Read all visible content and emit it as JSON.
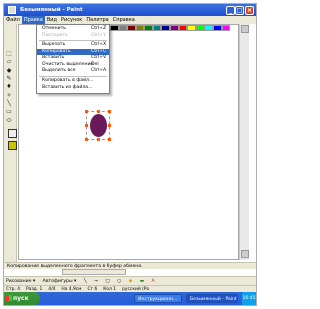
{
  "window": {
    "title": "Безымянный - Paint"
  },
  "menubar": {
    "items": [
      "Файл",
      "Правка",
      "Вид",
      "Рисунок",
      "Палитра",
      "Справка"
    ]
  },
  "edit_menu": {
    "items": [
      {
        "label": "Отменить",
        "shortcut": "Ctrl+Z",
        "state": "normal"
      },
      {
        "label": "Повторить",
        "shortcut": "Ctrl+Y",
        "state": "disabled"
      },
      {
        "label": "Вырезать",
        "shortcut": "Ctrl+X",
        "state": "normal"
      },
      {
        "label": "Копировать",
        "shortcut": "Ctrl+C",
        "state": "highlighted"
      },
      {
        "label": "Вставить",
        "shortcut": "Ctrl+V",
        "state": "normal"
      },
      {
        "label": "Очистить выделение",
        "shortcut": "Del",
        "state": "normal"
      },
      {
        "label": "Выделить все",
        "shortcut": "Ctrl+A",
        "state": "normal"
      },
      {
        "label": "Копировать в файл...",
        "shortcut": "",
        "state": "normal"
      },
      {
        "label": "Вставить из файла...",
        "shortcut": "",
        "state": "normal"
      }
    ]
  },
  "status": {
    "text": "Копирование выделенного фрагмента в буфер обмена."
  },
  "word_toolbar": {
    "draw_label": "Рисование ▾",
    "autoshapes_label": "Автофигуры ▾"
  },
  "doc_status": {
    "page": "Стр. 4",
    "section": "Разд. 1",
    "pages": "4/4",
    "position": "На 4,9см",
    "line": "Ст 6",
    "column": "Кол 1",
    "lang": "русский (Ро"
  },
  "taskbar": {
    "start_label": "пуск",
    "tasks": [
      "Инструкционн...",
      "Безымянный - Paint"
    ],
    "tray": "16:45"
  },
  "colors": {
    "title_blue": "#245edb",
    "menu_highlight": "#316ac5",
    "ellipse": "#6a1a5a",
    "start_green": "#3c9a3c"
  }
}
